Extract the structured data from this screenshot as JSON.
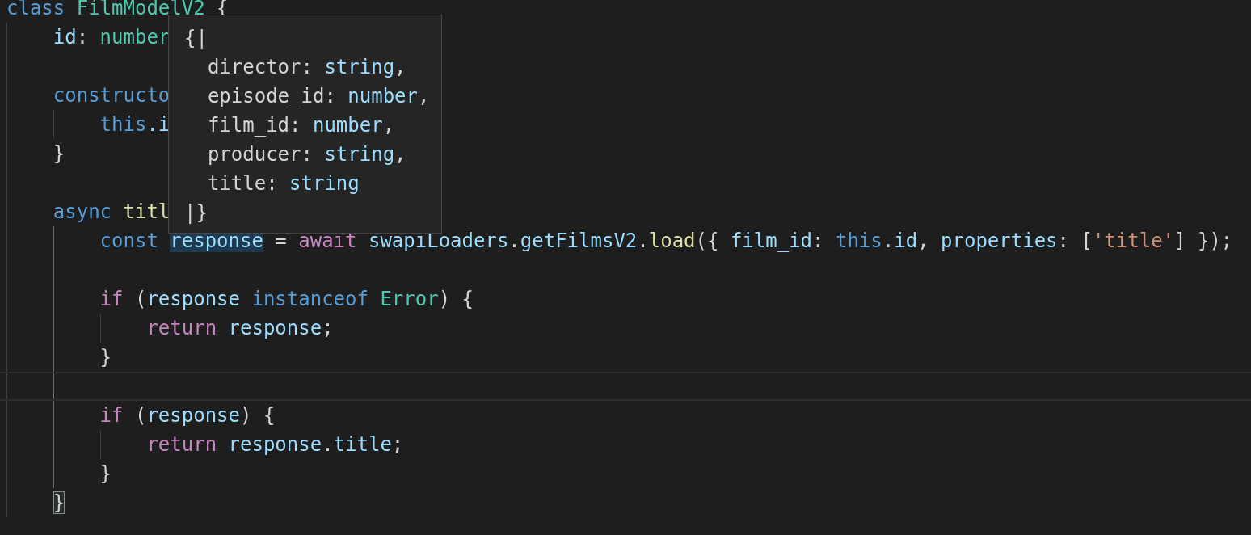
{
  "editor": {
    "lines": [
      {
        "kind": "code",
        "tokens": [
          {
            "t": "class ",
            "kind": "keyword"
          },
          {
            "t": "FilmModelV2",
            "kind": "type"
          },
          {
            "t": " {",
            "kind": "punct"
          }
        ],
        "children": [
          {
            "kind": "code",
            "tokens": [
              {
                "t": "id",
                "kind": "variable"
              },
              {
                "t": ": ",
                "kind": "punct"
              },
              {
                "t": "number",
                "kind": "type"
              }
            ]
          },
          {
            "kind": "blank"
          },
          {
            "kind": "code",
            "tokens": [
              {
                "t": "constructo",
                "kind": "keyword"
              }
            ],
            "children": [
              {
                "kind": "code",
                "tokens": [
                  {
                    "t": "this",
                    "kind": "keyword"
                  },
                  {
                    "t": ".i",
                    "kind": "variable"
                  }
                ]
              }
            ]
          },
          {
            "kind": "code",
            "tokens": [
              {
                "t": "}",
                "kind": "punct"
              }
            ]
          },
          {
            "kind": "blank"
          },
          {
            "kind": "code",
            "active_guide": true,
            "tokens": [
              {
                "t": "async ",
                "kind": "keyword"
              },
              {
                "t": "titl",
                "kind": "function"
              }
            ],
            "children": [
              {
                "kind": "code",
                "tokens": [
                  {
                    "t": "const ",
                    "kind": "keyword"
                  },
                  {
                    "t": "response",
                    "kind": "variable",
                    "highlighted": true
                  },
                  {
                    "t": " = ",
                    "kind": "punct"
                  },
                  {
                    "t": "await",
                    "kind": "control"
                  },
                  {
                    "t": " swapiLoaders",
                    "kind": "variable"
                  },
                  {
                    "t": ".",
                    "kind": "punct"
                  },
                  {
                    "t": "getFilmsV2",
                    "kind": "variable"
                  },
                  {
                    "t": ".",
                    "kind": "punct"
                  },
                  {
                    "t": "load",
                    "kind": "function"
                  },
                  {
                    "t": "({ ",
                    "kind": "punct"
                  },
                  {
                    "t": "film_id",
                    "kind": "variable"
                  },
                  {
                    "t": ": ",
                    "kind": "punct"
                  },
                  {
                    "t": "this",
                    "kind": "keyword"
                  },
                  {
                    "t": ".",
                    "kind": "punct"
                  },
                  {
                    "t": "id",
                    "kind": "variable"
                  },
                  {
                    "t": ", ",
                    "kind": "punct"
                  },
                  {
                    "t": "properties",
                    "kind": "variable"
                  },
                  {
                    "t": ": [",
                    "kind": "punct"
                  },
                  {
                    "t": "'title'",
                    "kind": "string"
                  },
                  {
                    "t": "] });",
                    "kind": "punct"
                  }
                ]
              },
              {
                "kind": "blank"
              },
              {
                "kind": "code",
                "tokens": [
                  {
                    "t": "if",
                    "kind": "control"
                  },
                  {
                    "t": " (",
                    "kind": "punct"
                  },
                  {
                    "t": "response ",
                    "kind": "variable"
                  },
                  {
                    "t": "instanceof ",
                    "kind": "keyword"
                  },
                  {
                    "t": "Error",
                    "kind": "type"
                  },
                  {
                    "t": ") {",
                    "kind": "punct"
                  }
                ],
                "children": [
                  {
                    "kind": "code",
                    "tokens": [
                      {
                        "t": "return ",
                        "kind": "control"
                      },
                      {
                        "t": "response",
                        "kind": "variable"
                      },
                      {
                        "t": ";",
                        "kind": "punct"
                      }
                    ]
                  }
                ]
              },
              {
                "kind": "code",
                "tokens": [
                  {
                    "t": "}",
                    "kind": "punct"
                  }
                ]
              },
              {
                "kind": "blank",
                "current": true
              },
              {
                "kind": "code",
                "tokens": [
                  {
                    "t": "if",
                    "kind": "control"
                  },
                  {
                    "t": " (",
                    "kind": "punct"
                  },
                  {
                    "t": "response",
                    "kind": "variable"
                  },
                  {
                    "t": ") {",
                    "kind": "punct"
                  }
                ],
                "children": [
                  {
                    "kind": "code",
                    "tokens": [
                      {
                        "t": "return ",
                        "kind": "control"
                      },
                      {
                        "t": "response",
                        "kind": "variable"
                      },
                      {
                        "t": ".",
                        "kind": "punct"
                      },
                      {
                        "t": "title",
                        "kind": "variable"
                      },
                      {
                        "t": ";",
                        "kind": "punct"
                      }
                    ]
                  }
                ]
              },
              {
                "kind": "code",
                "tokens": [
                  {
                    "t": "}",
                    "kind": "punct"
                  }
                ]
              }
            ]
          },
          {
            "kind": "code",
            "tokens": [
              {
                "t": "}",
                "kind": "punct",
                "matched": true
              }
            ]
          }
        ]
      }
    ]
  },
  "tooltip": {
    "lines": [
      {
        "tokens": [
          {
            "t": "{|"
          }
        ],
        "children": [
          {
            "tokens": [
              {
                "t": "director: ",
                "kind": "plain"
              },
              {
                "t": "string",
                "kind": "variable"
              },
              {
                "t": ",",
                "kind": "plain"
              }
            ]
          },
          {
            "tokens": [
              {
                "t": "episode_id: ",
                "kind": "plain"
              },
              {
                "t": "number",
                "kind": "variable"
              },
              {
                "t": ",",
                "kind": "plain"
              }
            ]
          },
          {
            "tokens": [
              {
                "t": "film_id: ",
                "kind": "plain"
              },
              {
                "t": "number",
                "kind": "variable"
              },
              {
                "t": ",",
                "kind": "plain"
              }
            ]
          },
          {
            "tokens": [
              {
                "t": "producer: ",
                "kind": "plain"
              },
              {
                "t": "string",
                "kind": "variable"
              },
              {
                "t": ",",
                "kind": "plain"
              }
            ]
          },
          {
            "tokens": [
              {
                "t": "title: ",
                "kind": "plain"
              },
              {
                "t": "string",
                "kind": "variable"
              }
            ]
          }
        ]
      },
      {
        "tokens": [
          {
            "t": "|}"
          }
        ]
      }
    ]
  }
}
